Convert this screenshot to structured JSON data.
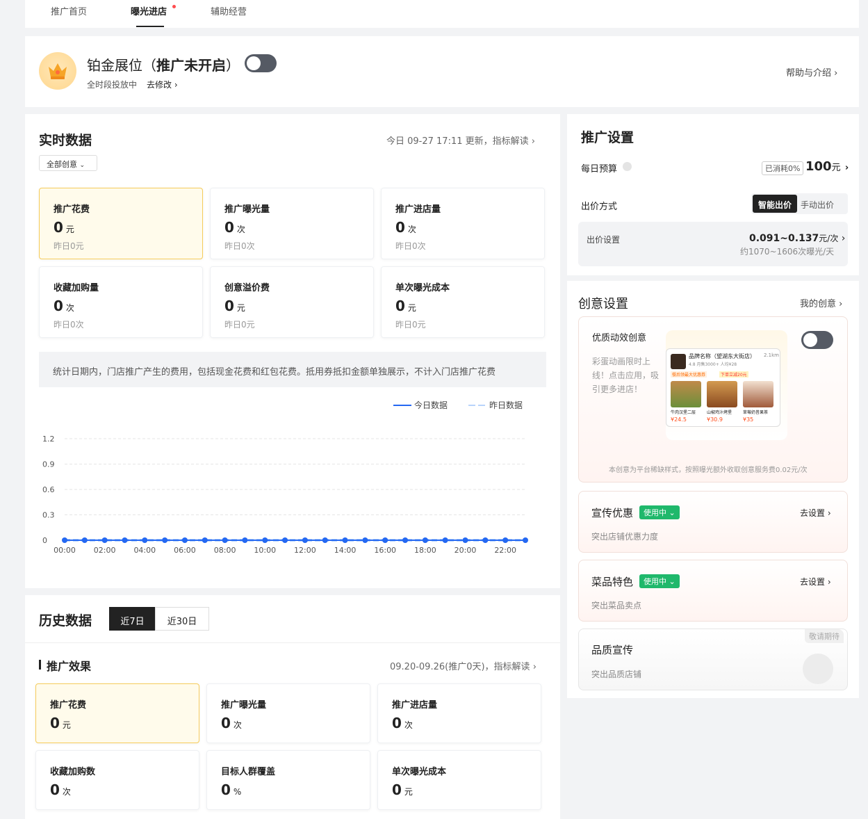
{
  "tabs": [
    "推广首页",
    "曝光进店",
    "辅助经营"
  ],
  "header": {
    "title_prefix": "铂金展位（",
    "title_bold": "推广未开启",
    "title_suffix": "）",
    "schedule": "全时段投放中",
    "edit_link": "去修改",
    "help": "帮助与介绍",
    "toggle_on": false
  },
  "realtime": {
    "title": "实时数据",
    "updated": "今日 09-27 17:11 更新，指标解读",
    "filter": "全部创意",
    "metrics": [
      {
        "label": "推广花费",
        "value": "0",
        "unit": "元",
        "prev": "昨日0元"
      },
      {
        "label": "推广曝光量",
        "value": "0",
        "unit": "次",
        "prev": "昨日0次"
      },
      {
        "label": "推广进店量",
        "value": "0",
        "unit": "次",
        "prev": "昨日0次"
      },
      {
        "label": "收藏加购量",
        "value": "0",
        "unit": "次",
        "prev": "昨日0次"
      },
      {
        "label": "创意溢价费",
        "value": "0",
        "unit": "元",
        "prev": "昨日0元"
      },
      {
        "label": "单次曝光成本",
        "value": "0",
        "unit": "元",
        "prev": "昨日0元"
      }
    ],
    "note": "统计日期内，门店推广产生的费用，包括现金花费和红包花费。抵用券抵扣金额单独展示，不计入门店推广花费"
  },
  "chart_data": {
    "type": "line",
    "x": [
      "00:00",
      "01:00",
      "02:00",
      "03:00",
      "04:00",
      "05:00",
      "06:00",
      "07:00",
      "08:00",
      "09:00",
      "10:00",
      "11:00",
      "12:00",
      "13:00",
      "14:00",
      "15:00",
      "16:00",
      "17:00",
      "18:00",
      "19:00",
      "20:00",
      "21:00",
      "22:00",
      "23:00"
    ],
    "x_tick_labels": [
      "00:00",
      "02:00",
      "04:00",
      "06:00",
      "08:00",
      "10:00",
      "12:00",
      "14:00",
      "16:00",
      "18:00",
      "20:00",
      "22:00"
    ],
    "y_tick_labels": [
      "1.2",
      "0.9",
      "0.6",
      "0.3",
      "0"
    ],
    "ylim": [
      0,
      1.2
    ],
    "series": [
      {
        "name": "今日数据",
        "values": [
          0,
          0,
          0,
          0,
          0,
          0,
          0,
          0,
          0,
          0,
          0,
          0,
          0,
          0,
          0,
          0,
          0,
          0,
          0,
          0,
          0,
          0,
          0,
          0
        ],
        "color": "#2468f2"
      },
      {
        "name": "昨日数据",
        "values": [
          0,
          0,
          0,
          0,
          0,
          0,
          0,
          0,
          0,
          0,
          0,
          0,
          0,
          0,
          0,
          0,
          0,
          0,
          0,
          0,
          0,
          0,
          0,
          0
        ],
        "color": "#b8d4fb"
      }
    ],
    "legend": "top-right",
    "grid": true
  },
  "history": {
    "title": "历史数据",
    "ranges": [
      "近7日",
      "近30日"
    ],
    "section": "推广效果",
    "period": "09.20-09.26(推广0天)，指标解读",
    "metrics": [
      {
        "label": "推广花费",
        "value": "0",
        "unit": "元"
      },
      {
        "label": "推广曝光量",
        "value": "0",
        "unit": "次"
      },
      {
        "label": "推广进店量",
        "value": "0",
        "unit": "次"
      },
      {
        "label": "收藏加购数",
        "value": "0",
        "unit": "次"
      },
      {
        "label": "目标人群覆盖",
        "value": "0",
        "unit": "%"
      },
      {
        "label": "单次曝光成本",
        "value": "0",
        "unit": "元"
      }
    ]
  },
  "settings": {
    "title": "推广设置",
    "budget_label": "每日预算",
    "consumed": "已消耗0%",
    "budget_value": "100",
    "budget_unit": "元",
    "bid_mode_label": "出价方式",
    "bid_modes": [
      "智能出价",
      "手动出价"
    ],
    "bid_setting_label": "出价设置",
    "bid_range": "0.091~0.137",
    "bid_unit": "元/次",
    "bid_estimate": "约1070~1606次曝光/天"
  },
  "creative": {
    "title": "创意设置",
    "my_link": "我的创意",
    "premium": {
      "title": "优质动效创意",
      "desc": "彩蛋动画限时上线！点击应用，吸引更多进店！",
      "footnote": "本创意为平台稀缺样式，按照曝光额外收取创意服务费0.02元/次",
      "toggle_on": false,
      "preview": {
        "shop": "品牌名称（望湖东大街店）",
        "rating": "4.8  月售3000+  人均¥28",
        "distance": "2.1km",
        "promos": [
          "餐后领最大优惠券",
          "下单立减20元"
        ],
        "items": [
          {
            "name": "牛肉汉堡二层",
            "price": "¥24.5"
          },
          {
            "name": "山椒鸡汁烤堡",
            "price": "¥30.9"
          },
          {
            "name": "草莓奶昔果茶",
            "price": "¥35"
          }
        ]
      }
    },
    "items": [
      {
        "title": "宣传优惠",
        "badge": "使用中",
        "action": "去设置",
        "sub": "突出店铺优惠力度"
      },
      {
        "title": "菜品特色",
        "badge": "使用中",
        "action": "去设置",
        "sub": "突出菜品卖点"
      },
      {
        "title": "品质宣传",
        "badge": "敬请期待",
        "action": "",
        "sub": "突出品质店铺"
      }
    ]
  },
  "arrow": "›",
  "caret": "⌄"
}
